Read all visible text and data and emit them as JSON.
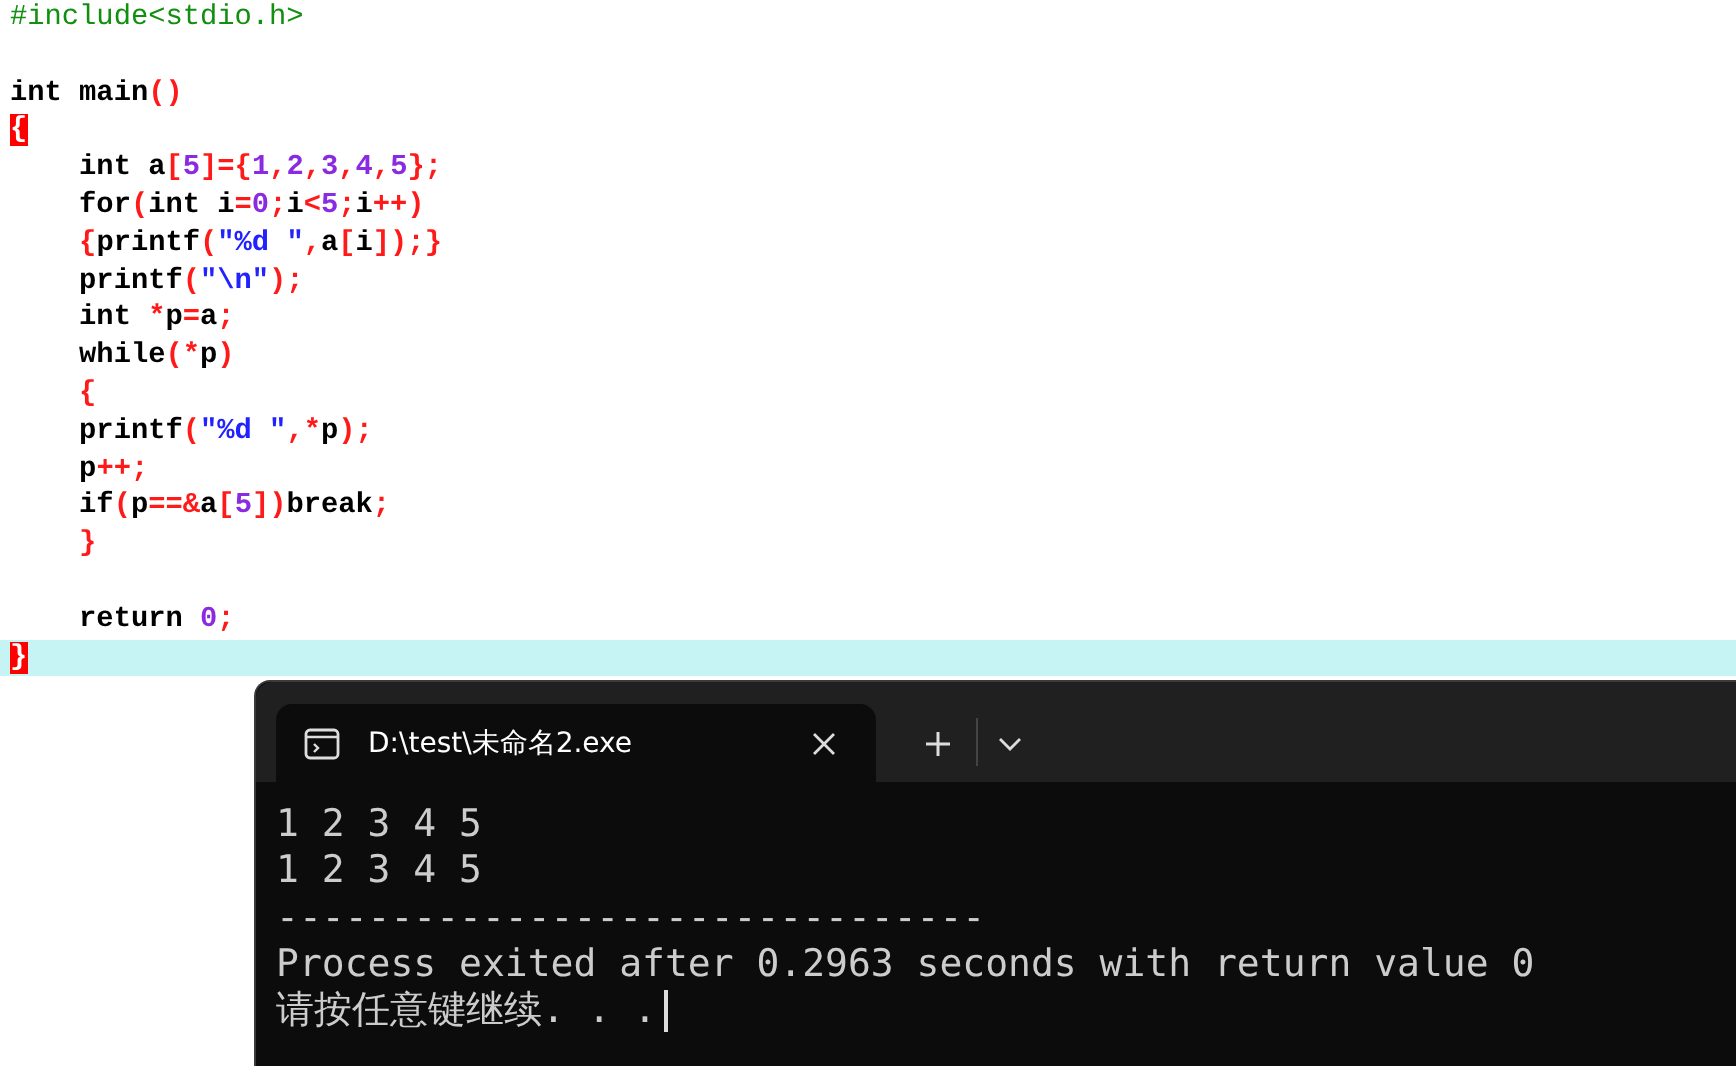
{
  "editor": {
    "lines": [
      {
        "current": false,
        "tokens": [
          {
            "kind": "preprocessor",
            "text": "#include<stdio.h>"
          }
        ]
      },
      {
        "current": false
      },
      {
        "current": false,
        "tokens": [
          {
            "kind": "plain",
            "text": "int main"
          },
          {
            "kind": "symbol",
            "text": "()"
          }
        ]
      },
      {
        "current": false,
        "tokens": [
          {
            "kind": "brace-match",
            "text": "{"
          }
        ]
      },
      {
        "current": false,
        "tokens": [
          {
            "kind": "plain",
            "text": "    int a"
          },
          {
            "kind": "symbol",
            "text": "["
          },
          {
            "kind": "number",
            "text": "5"
          },
          {
            "kind": "symbol",
            "text": "]={"
          },
          {
            "kind": "number",
            "text": "1"
          },
          {
            "kind": "symbol",
            "text": ","
          },
          {
            "kind": "number",
            "text": "2"
          },
          {
            "kind": "symbol",
            "text": ","
          },
          {
            "kind": "number",
            "text": "3"
          },
          {
            "kind": "symbol",
            "text": ","
          },
          {
            "kind": "number",
            "text": "4"
          },
          {
            "kind": "symbol",
            "text": ","
          },
          {
            "kind": "number",
            "text": "5"
          },
          {
            "kind": "symbol",
            "text": "};"
          }
        ]
      },
      {
        "current": false,
        "tokens": [
          {
            "kind": "plain",
            "text": "    for"
          },
          {
            "kind": "symbol",
            "text": "("
          },
          {
            "kind": "plain",
            "text": "int i"
          },
          {
            "kind": "symbol",
            "text": "="
          },
          {
            "kind": "number",
            "text": "0"
          },
          {
            "kind": "symbol",
            "text": ";"
          },
          {
            "kind": "plain",
            "text": "i"
          },
          {
            "kind": "symbol",
            "text": "<"
          },
          {
            "kind": "number",
            "text": "5"
          },
          {
            "kind": "symbol",
            "text": ";"
          },
          {
            "kind": "plain",
            "text": "i"
          },
          {
            "kind": "symbol",
            "text": "++)"
          }
        ]
      },
      {
        "current": false,
        "tokens": [
          {
            "kind": "symbol",
            "text": "    {"
          },
          {
            "kind": "plain",
            "text": "printf"
          },
          {
            "kind": "symbol",
            "text": "("
          },
          {
            "kind": "string",
            "text": "\"%d \""
          },
          {
            "kind": "symbol",
            "text": ","
          },
          {
            "kind": "plain",
            "text": "a"
          },
          {
            "kind": "symbol",
            "text": "["
          },
          {
            "kind": "plain",
            "text": "i"
          },
          {
            "kind": "symbol",
            "text": "]);}"
          }
        ]
      },
      {
        "current": false,
        "tokens": [
          {
            "kind": "plain",
            "text": "    printf"
          },
          {
            "kind": "symbol",
            "text": "("
          },
          {
            "kind": "string",
            "text": "\"\\n\""
          },
          {
            "kind": "symbol",
            "text": ");"
          }
        ]
      },
      {
        "current": false,
        "tokens": [
          {
            "kind": "plain",
            "text": "    int "
          },
          {
            "kind": "symbol",
            "text": "*"
          },
          {
            "kind": "plain",
            "text": "p"
          },
          {
            "kind": "symbol",
            "text": "="
          },
          {
            "kind": "plain",
            "text": "a"
          },
          {
            "kind": "symbol",
            "text": ";"
          }
        ]
      },
      {
        "current": false,
        "tokens": [
          {
            "kind": "plain",
            "text": "    while"
          },
          {
            "kind": "symbol",
            "text": "(*"
          },
          {
            "kind": "plain",
            "text": "p"
          },
          {
            "kind": "symbol",
            "text": ")"
          }
        ]
      },
      {
        "current": false,
        "tokens": [
          {
            "kind": "symbol",
            "text": "    {"
          }
        ]
      },
      {
        "current": false,
        "tokens": [
          {
            "kind": "plain",
            "text": "    printf"
          },
          {
            "kind": "symbol",
            "text": "("
          },
          {
            "kind": "string",
            "text": "\"%d \""
          },
          {
            "kind": "symbol",
            "text": ",*"
          },
          {
            "kind": "plain",
            "text": "p"
          },
          {
            "kind": "symbol",
            "text": ");"
          }
        ]
      },
      {
        "current": false,
        "tokens": [
          {
            "kind": "plain",
            "text": "    p"
          },
          {
            "kind": "symbol",
            "text": "++;"
          }
        ]
      },
      {
        "current": false,
        "tokens": [
          {
            "kind": "plain",
            "text": "    if"
          },
          {
            "kind": "symbol",
            "text": "("
          },
          {
            "kind": "plain",
            "text": "p"
          },
          {
            "kind": "symbol",
            "text": "==&"
          },
          {
            "kind": "plain",
            "text": "a"
          },
          {
            "kind": "symbol",
            "text": "["
          },
          {
            "kind": "number",
            "text": "5"
          },
          {
            "kind": "symbol",
            "text": "])"
          },
          {
            "kind": "plain",
            "text": "break"
          },
          {
            "kind": "symbol",
            "text": ";"
          }
        ]
      },
      {
        "current": false,
        "tokens": [
          {
            "kind": "symbol",
            "text": "    }"
          }
        ]
      },
      {
        "current": false
      },
      {
        "current": false,
        "tokens": [
          {
            "kind": "plain",
            "text": "    return "
          },
          {
            "kind": "number",
            "text": "0"
          },
          {
            "kind": "symbol",
            "text": ";"
          }
        ]
      },
      {
        "current": true,
        "tokens": [
          {
            "kind": "brace-match",
            "text": "}"
          }
        ]
      }
    ]
  },
  "console": {
    "tab": {
      "title": "D:\\test\\未命名2.exe",
      "selected": true
    },
    "output": [
      "1 2 3 4 5",
      "1 2 3 4 5",
      "-------------------------------",
      "Process exited after 0.2963 seconds with return value 0",
      "请按任意键继续. . ."
    ]
  }
}
